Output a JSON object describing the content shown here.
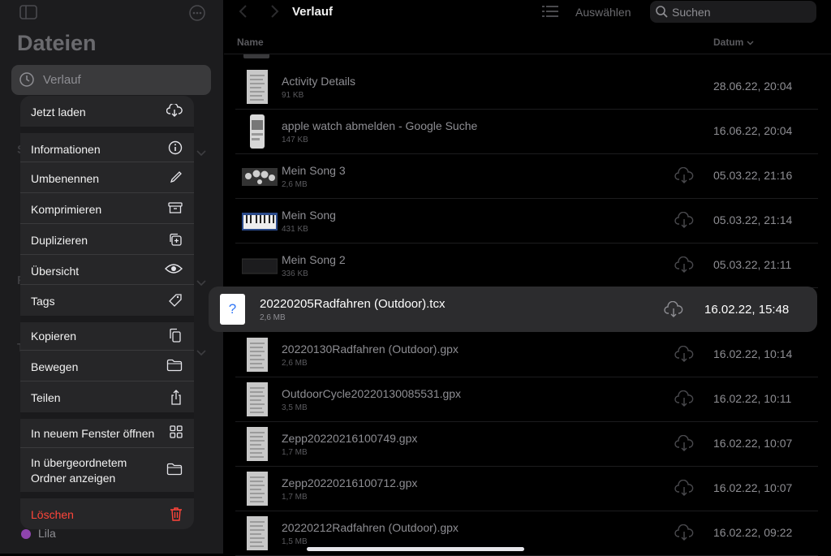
{
  "sidebar": {
    "title": "Dateien",
    "recent_label": "Verlauf",
    "faint_letters": [
      "S",
      "F",
      "T"
    ],
    "tag_lila": "Lila"
  },
  "context_menu": {
    "items": [
      {
        "label": "Jetzt laden",
        "icon": "cloud-download-icon"
      },
      {
        "label": "Informationen",
        "icon": "info-icon"
      },
      {
        "label": "Umbenennen",
        "icon": "pencil-icon"
      },
      {
        "label": "Komprimieren",
        "icon": "archive-box-icon"
      },
      {
        "label": "Duplizieren",
        "icon": "duplicate-icon"
      },
      {
        "label": "Übersicht",
        "icon": "eye-icon"
      },
      {
        "label": "Tags",
        "icon": "tag-icon"
      },
      {
        "label": "Kopieren",
        "icon": "copy-doc-icon"
      },
      {
        "label": "Bewegen",
        "icon": "folder-icon"
      },
      {
        "label": "Teilen",
        "icon": "share-icon"
      },
      {
        "label": "In neuem Fenster öffnen",
        "icon": "grid-icon"
      },
      {
        "label": "In übergeordnetem\nOrdner anzeigen",
        "icon": "folder-icon"
      },
      {
        "label": "Löschen",
        "icon": "trash-icon",
        "destructive": true,
        "color": "#ff453a"
      }
    ]
  },
  "toolbar": {
    "title": "Verlauf",
    "select_label": "Auswählen",
    "search_placeholder": "Suchen"
  },
  "columns": {
    "name": "Name",
    "date": "Datum"
  },
  "files": [
    {
      "name": "Activity Details",
      "size": "91 KB",
      "date": "28.06.22, 20:04",
      "thumb": "document",
      "cloud": false
    },
    {
      "name": "apple watch abmelden - Google Suche",
      "size": "147 KB",
      "date": "16.06.22, 20:04",
      "thumb": "phone",
      "cloud": false
    },
    {
      "name": "Mein Song 3",
      "size": "2,6 MB",
      "date": "05.03.22, 21:16",
      "thumb": "drums",
      "cloud": true
    },
    {
      "name": "Mein Song",
      "size": "431 KB",
      "date": "05.03.22, 21:14",
      "thumb": "keyboard",
      "cloud": true
    },
    {
      "name": "Mein Song 2",
      "size": "336 KB",
      "date": "05.03.22, 21:11",
      "thumb": "dark",
      "cloud": true
    },
    {
      "name": "20220205Radfahren (Outdoor).tcx",
      "size": "2,6 MB",
      "date": "16.02.22, 15:48",
      "thumb": "unknown",
      "cloud": true,
      "selected": true
    },
    {
      "name": "20220130Radfahren (Outdoor).gpx",
      "size": "2,6 MB",
      "date": "16.02.22, 10:14",
      "thumb": "document",
      "cloud": true
    },
    {
      "name": "OutdoorCycle20220130085531.gpx",
      "size": "3,5 MB",
      "date": "16.02.22, 10:11",
      "thumb": "document",
      "cloud": true
    },
    {
      "name": "Zepp20220216100749.gpx",
      "size": "1,7 MB",
      "date": "16.02.22, 10:07",
      "thumb": "document",
      "cloud": true
    },
    {
      "name": "Zepp20220216100712.gpx",
      "size": "1,7 MB",
      "date": "16.02.22, 10:07",
      "thumb": "document",
      "cloud": true
    },
    {
      "name": "20220212Radfahren (Outdoor).gpx",
      "size": "1,5 MB",
      "date": "16.02.22, 09:22",
      "thumb": "document",
      "cloud": true
    }
  ],
  "selected_thumb_glyph": "?",
  "colors": {
    "accent": "#3478f6",
    "destructive": "#ff453a",
    "tag_purple": "#8e44ad"
  }
}
